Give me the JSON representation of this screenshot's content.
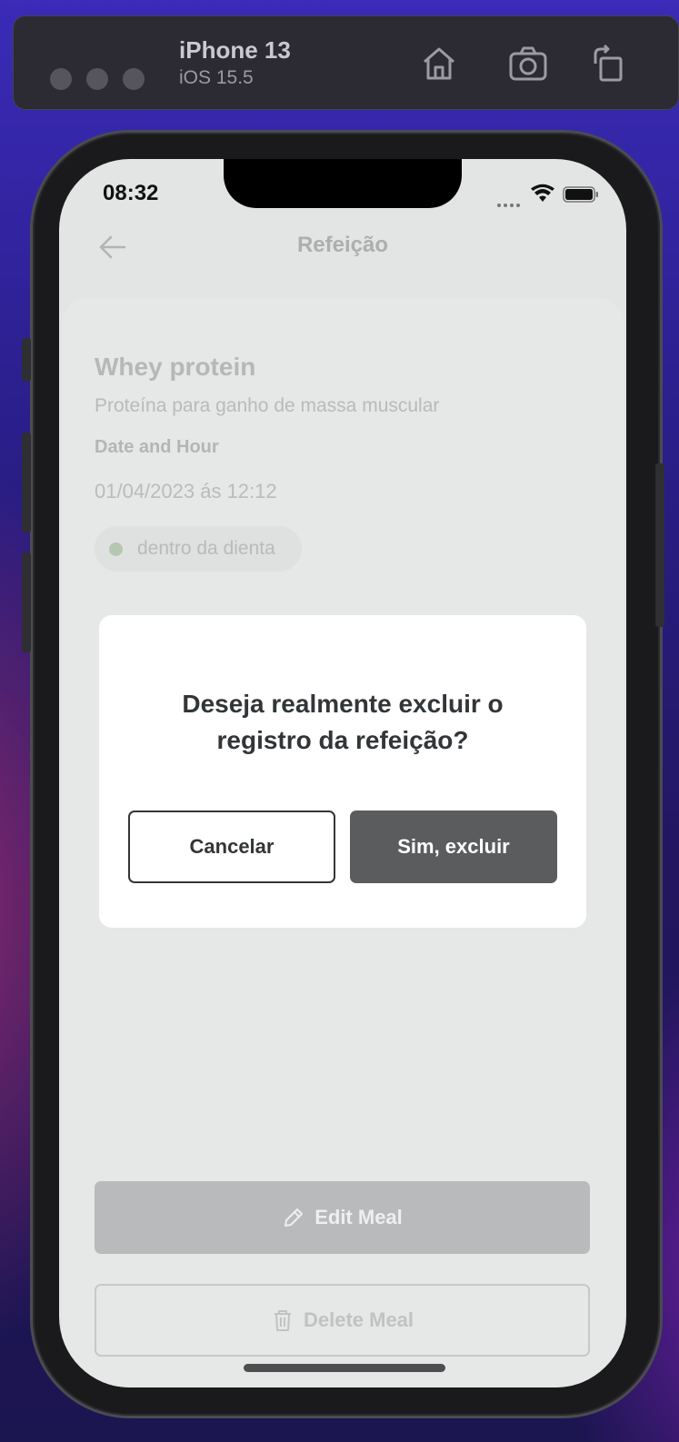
{
  "simulator": {
    "device_name": "iPhone 13",
    "os_version": "iOS 15.5",
    "icons": [
      "home-icon",
      "screenshot-icon",
      "rotate-icon"
    ]
  },
  "status_bar": {
    "time": "08:32"
  },
  "header": {
    "title": "Refeição"
  },
  "meal": {
    "name": "Whey protein",
    "description": "Proteína para ganho de massa muscular",
    "date_label": "Date and Hour",
    "date_value": "01/04/2023 ás 12:12",
    "diet_status": "dentro da dienta",
    "diet_color": "#b7c6b3"
  },
  "actions": {
    "edit_label": "Edit Meal",
    "delete_label": "Delete Meal"
  },
  "modal": {
    "title": "Deseja realmente excluir o registro da refeição?",
    "cancel_label": "Cancelar",
    "confirm_label": "Sim, excluir"
  },
  "colors": {
    "confirm_button": "#5b5c5e",
    "text_dark": "#333638"
  }
}
